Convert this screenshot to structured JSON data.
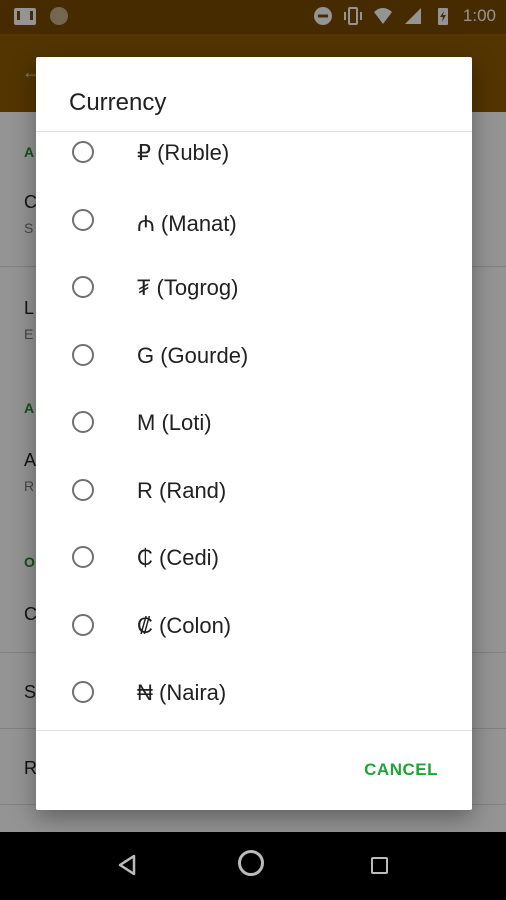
{
  "status_bar": {
    "time": "1:00",
    "icons": [
      "gmail-icon",
      "notification-dot-icon",
      "do-not-disturb-icon",
      "vibrate-icon",
      "wifi-icon",
      "signal-icon",
      "battery-charging-icon"
    ]
  },
  "dialog": {
    "title": "Currency",
    "options": [
      {
        "label": "₽ (Ruble)"
      },
      {
        "label": "₼ (Manat)"
      },
      {
        "label": "₮ (Togrog)"
      },
      {
        "label": "G (Gourde)"
      },
      {
        "label": "M (Loti)"
      },
      {
        "label": "R (Rand)"
      },
      {
        "label": "₵ (Cedi)"
      },
      {
        "label": "₡ (Colon)"
      },
      {
        "label": "₦ (Naira)"
      }
    ],
    "cancel_label": "CANCEL"
  },
  "colors": {
    "accent": "#1fa437",
    "appbar": "#8e5c00",
    "statusbar": "#7a4a00"
  }
}
